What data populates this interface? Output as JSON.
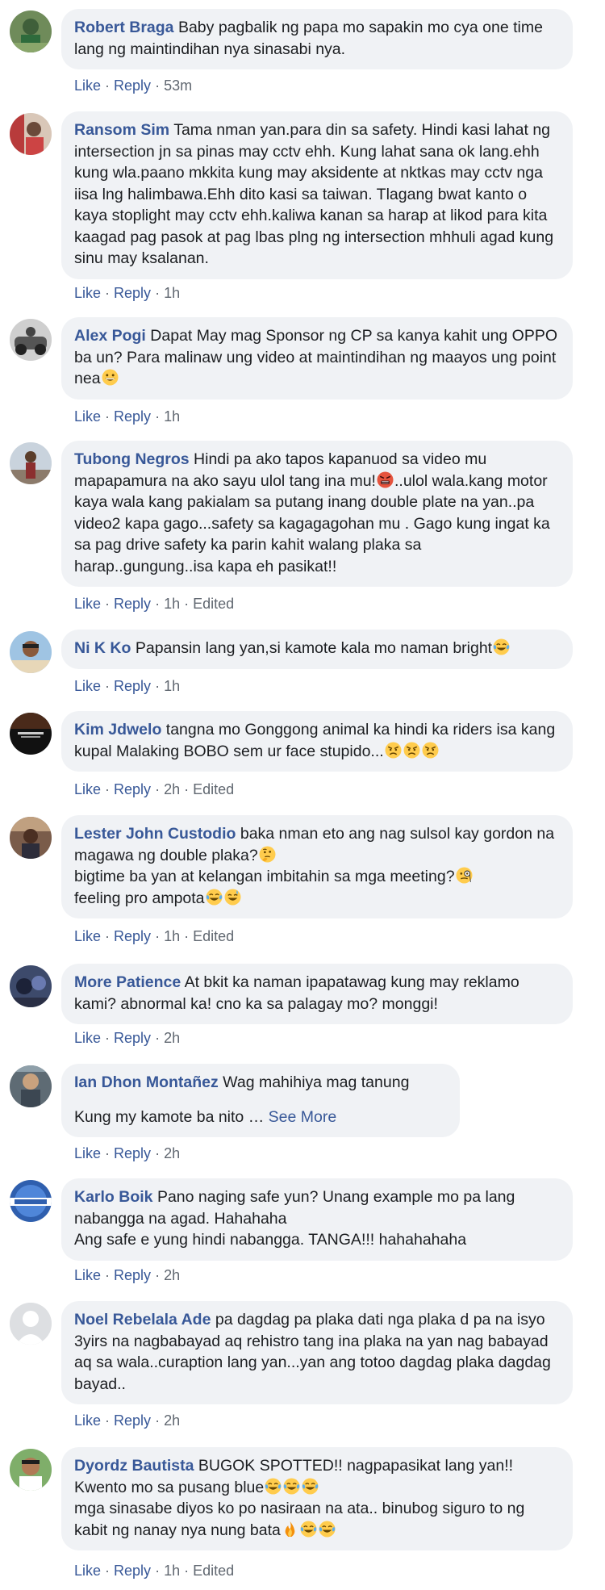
{
  "actions": {
    "like": "Like",
    "reply": "Reply",
    "sep": "·",
    "edited": "Edited"
  },
  "see_more_label": "See More",
  "comments": [
    {
      "author": "Robert Braga",
      "time": "53m",
      "text": [
        "Baby pagbalik ng papa mo sapakin mo cya one time lang ng maintindihan nya sinasabi nya."
      ]
    },
    {
      "author": "Ransom Sim",
      "time": "1h",
      "text": [
        "Tama nman yan.para din sa safety. Hindi kasi lahat ng intersection jn sa pinas may cctv ehh. Kung lahat sana ok lang.ehh kung wla.paano mkkita kung may aksidente at nktkas may cctv nga iisa lng halimbawa.Ehh dito kasi sa taiwan. Tlagang bwat kanto o kaya stoplight may cctv ehh.kaliwa kanan sa harap at likod para kita kaagad pag pasok at pag lbas plng ng intersection mhhuli agad kung sinu may ksalanan."
      ]
    },
    {
      "author": "Alex Pogi",
      "time": "1h",
      "text": [
        "Dapat May mag Sponsor ng CP sa kanya kahit ung OPPO ba un? Para malinaw ung video at maintindihan ng maayos ung point nea"
      ],
      "emojis": [
        "grin"
      ]
    },
    {
      "author": "Tubong Negros",
      "time": "1h",
      "edited": true,
      "text_parts": [
        "Hindi pa ako tapos kapanuod sa video mu mapapamura na ako sayu ulol tang ina mu!",
        "..ulol wala.kang motor kaya wala kang pakialam sa putang inang double plate na yan..pa video2 kapa gago...safety sa kagagagohan mu . Gago kung ingat ka sa pag drive safety ka parin kahit walang plaka sa harap..gungung..isa kapa eh pasikat!!"
      ]
    },
    {
      "author": "Ni K Ko",
      "time": "1h",
      "text": [
        "Papansin lang yan,si kamote kala mo naman bright"
      ],
      "emojis": [
        "joy"
      ]
    },
    {
      "author": "Kim Jdwelo",
      "time": "2h",
      "edited": true,
      "text": [
        "tangna mo Gonggong animal ka hindi ka riders isa kang kupal Malaking BOBO sem ur face stupido..."
      ],
      "emojis": [
        "angry",
        "angry",
        "angry"
      ]
    },
    {
      "author": "Lester John Custodio",
      "time": "1h",
      "edited": true,
      "text": [
        "baka nman eto ang nag sulsol kay gordon na magawa ng double plaka?",
        "bigtime ba yan at kelangan imbitahin sa mga meeting?",
        "feeling pro ampota"
      ]
    },
    {
      "author": "More Patience",
      "time": "2h",
      "text": [
        "At bkit ka naman ipapatawag kung may reklamo kami? abnormal ka! cno ka sa palagay mo? monggi!"
      ]
    },
    {
      "author": "Ian Dhon Montañez",
      "time": "2h",
      "text": [
        "Wag mahihiya mag tanung",
        "Kung my kamote ba nito …"
      ]
    },
    {
      "author": "Karlo Boik",
      "time": "2h",
      "text": [
        "Pano naging safe yun? Unang example mo pa lang nabangga na agad. Hahahaha",
        "Ang safe e yung hindi nabangga. TANGA!!! hahahahaha"
      ]
    },
    {
      "author": "Noel Rebelala Ade",
      "time": "2h",
      "text": [
        "pa dagdag pa plaka dati nga plaka d pa na isyo 3yirs na nagbabayad aq rehistro tang ina plaka na yan nag babayad aq sa wala..curaption lang yan...yan ang totoo dagdag plaka dagdag bayad.."
      ]
    },
    {
      "author": "Dyordz Bautista",
      "time": "1h",
      "edited": true,
      "text": [
        "BUGOK SPOTTED!! nagpapasikat lang yan!!",
        "Kwento mo sa pusang blue",
        "mga sinasabe diyos ko po nasiraan na ata.. binubog siguro to ng kabit ng nanay nya nung bata"
      ]
    }
  ]
}
